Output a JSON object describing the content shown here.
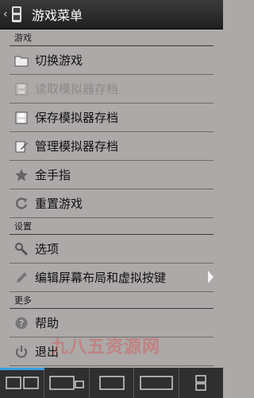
{
  "header": {
    "title": "游戏菜单",
    "back_icon": "chevron-left-icon",
    "app_icon": "game-app-icon"
  },
  "sections": [
    {
      "label": "游戏",
      "items": [
        {
          "label": "切换游戏",
          "icon": "folder-icon",
          "enabled": true
        },
        {
          "label": "读取模拟器存档",
          "icon": "floppy-disk-icon",
          "enabled": false
        },
        {
          "label": "保存模拟器存档",
          "icon": "floppy-disk-icon",
          "enabled": true
        },
        {
          "label": "管理模拟器存档",
          "icon": "edit-doc-icon",
          "enabled": true
        },
        {
          "label": "金手指",
          "icon": "star-icon",
          "enabled": true
        },
        {
          "label": "重置游戏",
          "icon": "refresh-icon",
          "enabled": true
        }
      ]
    },
    {
      "label": "设置",
      "items": [
        {
          "label": "选项",
          "icon": "wrench-icon",
          "enabled": true
        },
        {
          "label": "编辑屏幕布局和虚拟按键",
          "icon": "pencil-icon",
          "enabled": true,
          "has_submenu": true
        }
      ]
    },
    {
      "label": "更多",
      "items": [
        {
          "label": "帮助",
          "icon": "help-icon",
          "enabled": true
        },
        {
          "label": "退出",
          "icon": "power-icon",
          "enabled": true
        }
      ]
    }
  ],
  "watermark": "九八五资源网",
  "bottom_bar": {
    "accent_color": "#3aa0e0",
    "tabs": [
      "layout-two-screen-icon",
      "layout-main-small-icon",
      "layout-single-icon",
      "layout-wide-icon",
      "layout-stacked-icon"
    ]
  }
}
